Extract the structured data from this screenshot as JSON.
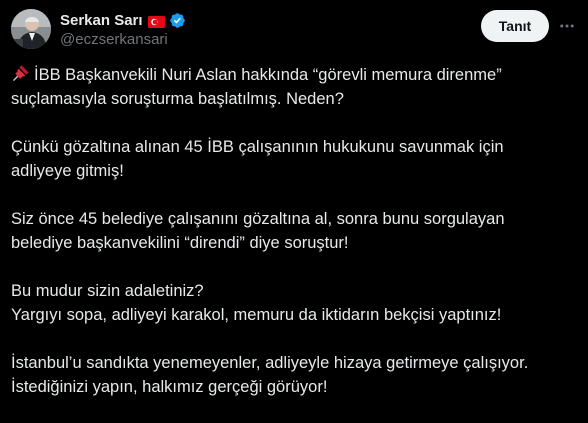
{
  "author": {
    "display_name": "Serkan Sarı",
    "handle": "@eczserkansari",
    "flag_icon": "turkish-flag-icon",
    "verified_icon": "verified-badge-icon",
    "verified_color": "#1d9bf0"
  },
  "actions": {
    "follow_label": "Tanıt",
    "more_icon": "more-options-icon"
  },
  "tweet": {
    "pin_icon": "pushpin-icon",
    "paragraphs": [
      {
        "lines": [
          "İBB Başkanvekili Nuri Aslan hakkında “görevli memura direnme”",
          "suçlamasıyla soruşturma başlatılmış. Neden?"
        ]
      },
      {
        "lines": [
          "Çünkü gözaltına alınan 45 İBB çalışanının hukukunu savunmak için",
          "adliyeye gitmiş!"
        ]
      },
      {
        "lines": [
          "Siz önce 45 belediye çalışanını gözaltına al, sonra bunu sorgulayan",
          "belediye başkanvekilini “direndi” diye soruştur!"
        ]
      },
      {
        "lines": [
          "Bu mudur sizin adaletiniz?",
          "Yargıyı sopa, adliyeyi karakol, memuru da iktidarın bekçisi yaptınız!"
        ]
      },
      {
        "lines": [
          "İstanbul’u sandıkta yenemeyenler, adliyeyle hizaya getirmeye çalışıyor.",
          "İstediğinizi yapın, halkımız gerçeği görüyor!"
        ]
      }
    ]
  },
  "colors": {
    "background": "#000000",
    "text": "#e7e9ea",
    "muted": "#71767b",
    "button_bg": "#eff3f4",
    "button_text": "#0f1419",
    "flag_red": "#e30a17"
  }
}
